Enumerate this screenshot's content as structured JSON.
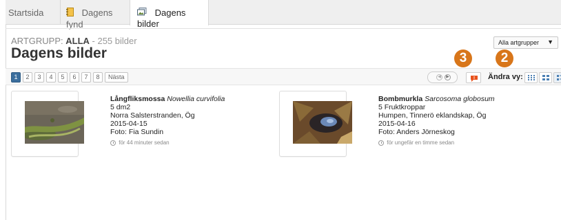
{
  "tabs": [
    {
      "label": "Startsida",
      "icon": "home"
    },
    {
      "label": "Dagens fynd",
      "icon": "notebook-icon"
    },
    {
      "label": "Dagens bilder",
      "icon": "image-gallery-icon",
      "active": true
    }
  ],
  "header": {
    "artgrupp_label": "ARTGRUPP:",
    "artgrupp_value": "ALLA",
    "count_text": "- 255 bilder",
    "title": "Dagens bilder"
  },
  "filter_select": {
    "selected": "Alla artgrupper"
  },
  "pagination": {
    "pages": [
      "1",
      "2",
      "3",
      "4",
      "5",
      "6",
      "7",
      "8"
    ],
    "active_page": "1",
    "next_label": "Nästa"
  },
  "toolbar": {
    "view_label": "Ändra vy:"
  },
  "badges": {
    "three": "3",
    "two": "2"
  },
  "colors": {
    "accent": "#3b6e9d",
    "badge": "#d8761a",
    "comment": "#e8521c"
  },
  "cards": [
    {
      "name": "Långfliksmossa",
      "latin": "Nowellia curvifolia",
      "quantity": "5 dm2",
      "place": "Norra Salsterstranden, Ög",
      "date": "2015-04-15",
      "photographer": "Foto: Fia Sundin",
      "time_ago": "för 44 minuter sedan"
    },
    {
      "name": "Bombmurkla",
      "latin": "Sarcosoma globosum",
      "quantity": "5 Fruktkroppar",
      "place": "Humpen, Tinnerö eklandskap, Ög",
      "date": "2015-04-16",
      "photographer": "Foto: Anders Jörneskog",
      "time_ago": "för ungefär en timme sedan"
    }
  ]
}
